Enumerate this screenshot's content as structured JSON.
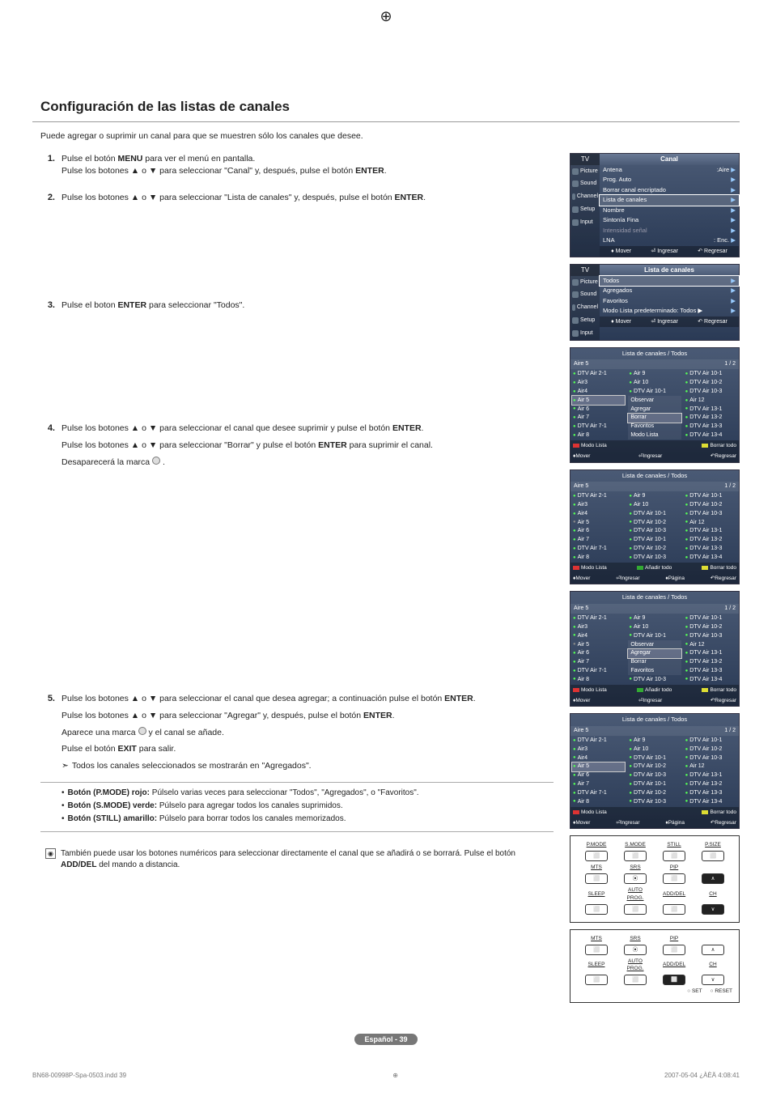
{
  "title": "Configuración de las listas de canales",
  "intro": "Puede agregar o suprimir un canal para que se muestren sólo los canales que desee.",
  "steps": {
    "s1a": "Pulse el botón ",
    "s1b": " para ver el menú en pantalla.",
    "s1c": "Pulse los botones ▲ o ▼ para seleccionar \"Canal\" y, después, pulse el botón ",
    "menu": "MENU",
    "enter": "ENTER",
    "s2a": "Pulse los botones ▲ o ▼ para seleccionar \"Lista de canales\" y, después, pulse el botón ",
    "s3a": "Pulse el boton ",
    "s3b": " para seleccionar \"Todos\".",
    "s4a": "Pulse los botones ▲ o ▼ para seleccionar el canal que desee suprimir y pulse el botón ",
    "s4b": "Pulse los botones ▲ o ▼ para seleccionar \"Borrar\" y pulse el botón ",
    "s4c": " para suprimir el canal.",
    "s4d": "Desaparecerá la marca ",
    "s5a": "Pulse los botones ▲ o ▼ para seleccionar el canal que desea agregar; a continuación pulse el botón ",
    "s5b": "Pulse los botones ▲ o ▼ para seleccionar \"Agregar\" y, después, pulse el botón ",
    "s5c": "Aparece una marca ",
    "s5c2": " y  el canal se añade.",
    "s5d": "Pulse el botón ",
    "exit": "EXIT",
    "s5d2": " para salir.",
    "s5e": "Todos los canales seleccionados se mostrarán en \"Agregados\"."
  },
  "button_notes": {
    "b1a": "Botón (P.MODE) rojo:",
    "b1b": " Púlselo varias veces para seleccionar \"Todos\", \"Agregados\", o \"Favoritos\".",
    "b2a": "Botón (S.MODE) verde:",
    "b2b": " Púlselo para agregar todos los canales suprimidos.",
    "b3a": "Botón (STILL) amarillo:",
    "b3b": " Púlselo para borrar todos los canales memorizados."
  },
  "foot_note": {
    "a": "También puede usar los botones numéricos para seleccionar directamente el canal que se añadirá o se borrará. Pulse el botón ",
    "b": "ADD/DEL",
    "c": " del mando a distancia."
  },
  "menu1": {
    "tv": "TV",
    "title": "Canal",
    "left": [
      "Picture",
      "Sound",
      "Channel",
      "Setup",
      "Input"
    ],
    "items": [
      {
        "l": "Antena",
        "r": ":Aire"
      },
      {
        "l": "Prog. Auto",
        "r": ""
      },
      {
        "l": "Borrar canal encriptado",
        "r": ""
      },
      {
        "l": "Lista de canales",
        "r": "",
        "sel": true
      },
      {
        "l": "Nombre",
        "r": ""
      },
      {
        "l": "Sintonía Fina",
        "r": ""
      },
      {
        "l": "Intensidad señal",
        "r": "",
        "dim": true
      },
      {
        "l": "LNA",
        "r": ": Enc."
      }
    ],
    "footer": [
      "Mover",
      "Ingresar",
      "Regresar"
    ]
  },
  "menu2": {
    "tv": "TV",
    "title": "Lista de canales",
    "left": [
      "Picture",
      "Sound",
      "Channel",
      "Setup",
      "Input"
    ],
    "items": [
      {
        "l": "Todos",
        "r": "",
        "sel": true
      },
      {
        "l": "Agregados",
        "r": ""
      },
      {
        "l": "Favoritos",
        "r": ""
      },
      {
        "l": "Modo Lista predeterminado: Todos ▶",
        "r": ""
      }
    ],
    "footer": [
      "Mover",
      "Ingresar",
      "Regresar"
    ]
  },
  "lists": {
    "title": "Lista de canales / Todos",
    "sub": "Aire 5",
    "page": "1 / 2",
    "col1": [
      "DTV Air 2-1",
      "Air3",
      "Air4",
      "Air 5",
      "Air 6",
      "Air 7",
      "DTV Air 7-1",
      "Air 8"
    ],
    "col2_a": [
      "Air 9",
      "Air 10",
      "DTV Air 10-1",
      "Observar",
      "Agregar",
      "Borrar",
      "Favoritos",
      "Modo Lista"
    ],
    "col2_b": [
      "Air 9",
      "Air 10",
      "DTV Air 10-1",
      "DTV Air 10-2",
      "DTV Air 10-3",
      "DTV Air 10-1",
      "DTV Air 10-2",
      "DTV Air 10-3"
    ],
    "col3": [
      "DTV Air 10-1",
      "DTV Air 10-2",
      "DTV Air 10-3",
      "Air 12",
      "DTV Air 13-1",
      "DTV Air 13-2",
      "DTV Air 13-3",
      "DTV Air 13-4"
    ],
    "popup_b": [
      "Observar",
      "Agregar",
      "Borrar",
      "Favoritos"
    ],
    "footer_labels": {
      "mover": "Mover",
      "ingresar": "Ingresar",
      "regresar": "Regresar",
      "pagina": "Página",
      "modo": "Modo Lista",
      "anadir": "Añadir todo",
      "borrart": "Borrar todo"
    },
    "borrar_sel": "Borrar",
    "agregar_sel": "Agregar"
  },
  "remote": {
    "top": [
      "P.MODE",
      "S.MODE",
      "STILL",
      "P.SIZE"
    ],
    "mid_lbl": [
      "MTS",
      "SRS",
      "PIP"
    ],
    "bot_lbl": [
      "SLEEP",
      "AUTO PROG.",
      "ADD/DEL",
      "CH"
    ],
    "set": "SET",
    "reset": "RESET"
  },
  "page_number": "Español - 39",
  "footer": {
    "left": "BN68-00998P-Spa-0503.indd   39",
    "right": "2007-05-04   ¿ÀÈÄ 4:08:41"
  }
}
